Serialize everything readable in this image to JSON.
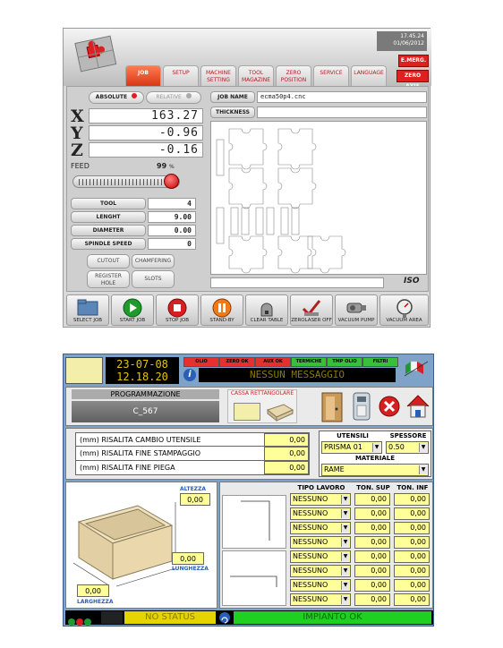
{
  "cnc": {
    "clock_time": "17.45.24",
    "clock_date": "01/06/2012",
    "emerg_label": "E.MERG.",
    "zero_axis_label": "ZERO AXIS",
    "tabs": [
      {
        "line1": "JOB",
        "line2": ""
      },
      {
        "line1": "SETUP",
        "line2": ""
      },
      {
        "line1": "MACHINE",
        "line2": "SETTING"
      },
      {
        "line1": "TOOL",
        "line2": "MAGAZINE"
      },
      {
        "line1": "ZERO",
        "line2": "POSITION"
      },
      {
        "line1": "SERVICE",
        "line2": ""
      },
      {
        "line1": "LANGUAGE",
        "line2": ""
      }
    ],
    "absolute_label": "ABSOLUTE",
    "relative_label": "RELATIVE",
    "axis_x": "X",
    "axis_y": "Y",
    "axis_z": "Z",
    "pos_x": "163.27",
    "pos_y": "-0.96",
    "pos_z": "-0.16",
    "feed_label": "FEED",
    "feed_value": "99",
    "feed_unit": "%",
    "feed_fraction": 0.99,
    "params": [
      {
        "label": "TOOL",
        "value": "4"
      },
      {
        "label": "LENGHT",
        "value": "9.00"
      },
      {
        "label": "DIAMETER",
        "value": "0.00"
      },
      {
        "label": "SPINDLE SPEED",
        "value": "0"
      }
    ],
    "buttons": [
      {
        "line1": "CUTOUT",
        "line2": ""
      },
      {
        "line1": "CHAMFERING",
        "line2": ""
      },
      {
        "line1": "REGISTER",
        "line2": "HOLE"
      },
      {
        "line1": "SLOTS",
        "line2": ""
      }
    ],
    "job_name_label": "JOB NAME",
    "job_name_value": "ecma50p4.cnc",
    "thickness_label": "THICKNESS",
    "thickness_value": "",
    "iso_label": "ISO",
    "toolbar": [
      {
        "label": "SELECT JOB",
        "icon": "folder-icon",
        "color": "#5b86b8"
      },
      {
        "label": "START JOB",
        "icon": "play-icon",
        "color": "#1f9a2d"
      },
      {
        "label": "STOP JOB",
        "icon": "stop-icon",
        "color": "#d42020"
      },
      {
        "label": "STAND-BY",
        "icon": "pause-icon",
        "color": "#f07a18"
      },
      {
        "label": "CLEAR TABLE",
        "icon": "clear-table-icon",
        "color": "#777777"
      },
      {
        "label": "ZEROLASER OFF",
        "icon": "laser-off-icon",
        "color": "#b02020"
      },
      {
        "label": "VACUUM PUMP",
        "icon": "vacuum-pump-icon",
        "color": "#777777"
      },
      {
        "label": "VACUUM AREA",
        "icon": "vacuum-gauge-icon",
        "color": "#777777"
      }
    ]
  },
  "press": {
    "date": "23-07-08",
    "time": "12.18.20",
    "status_chips": [
      {
        "label": "OLIO",
        "color": "#e53030"
      },
      {
        "label": "ZERO OK",
        "color": "#e53030"
      },
      {
        "label": "AUX OK",
        "color": "#e53030"
      },
      {
        "label": "TERMICHE",
        "color": "#38c038"
      },
      {
        "label": "TMP OLIO",
        "color": "#38c038"
      },
      {
        "label": "FILTRI",
        "color": "#38c038"
      }
    ],
    "message": "NESSUN MESSAGGIO",
    "programmazione_label": "PROGRAMMAZIONE",
    "program_name": "C_567",
    "shape_label": "CASSA RETTANGOLARE",
    "settings": [
      {
        "label": "(mm) RISALITA CAMBIO UTENSILE",
        "value": "0,00"
      },
      {
        "label": "(mm) RISALITA FINE STAMPAGGIO",
        "value": "0,00"
      },
      {
        "label": "(mm) RISALITA FINE PIEGA",
        "value": "0,00"
      }
    ],
    "utensili_label": "UTENSILI",
    "spessore_label": "SPESSORE",
    "utensili_value": "PRISMA 01",
    "spessore_value": "0.50",
    "materiale_label": "MATERIALE",
    "materiale_value": "RAME",
    "altezza_label": "ALTEZZA",
    "altezza_value": "0,00",
    "lunghezza_label": "LUNGHEZZA",
    "lunghezza_value": "0,00",
    "larghezza_label": "LARGHEZZA",
    "larghezza_value": "0,00",
    "table_headers": [
      "TIPO LAVORO",
      "TON. SUP",
      "TON. INF"
    ],
    "table_rows": [
      {
        "tipo": "NESSUNO",
        "sup": "0,00",
        "inf": "0,00"
      },
      {
        "tipo": "NESSUNO",
        "sup": "0,00",
        "inf": "0,00"
      },
      {
        "tipo": "NESSUNO",
        "sup": "0,00",
        "inf": "0,00"
      },
      {
        "tipo": "NESSUNO",
        "sup": "0,00",
        "inf": "0,00"
      },
      {
        "tipo": "NESSUNO",
        "sup": "0,00",
        "inf": "0,00"
      },
      {
        "tipo": "NESSUNO",
        "sup": "0,00",
        "inf": "0,00"
      },
      {
        "tipo": "NESSUNO",
        "sup": "0,00",
        "inf": "0,00"
      },
      {
        "tipo": "NESSUNO",
        "sup": "0,00",
        "inf": "0,00"
      }
    ],
    "footer_status": "NO STATUS",
    "footer_impianto": "IMPIANTO OK"
  }
}
